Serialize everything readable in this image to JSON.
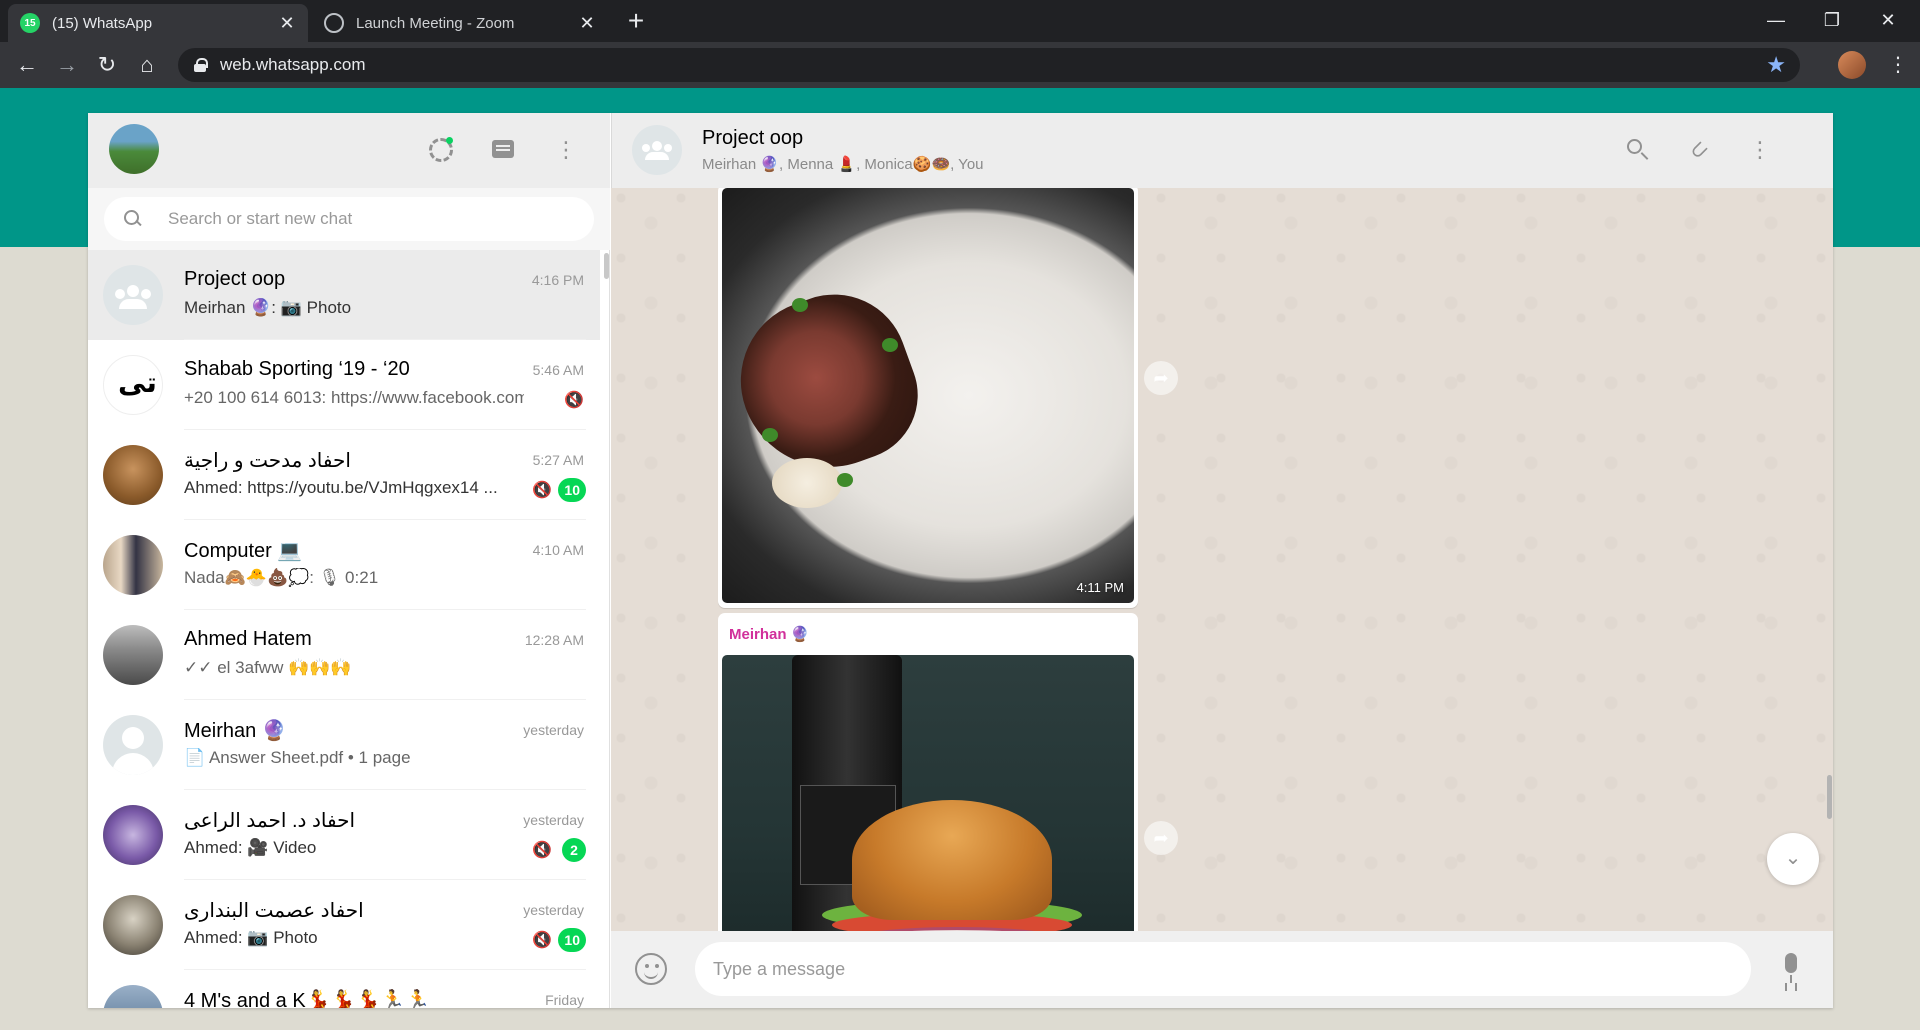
{
  "browser": {
    "tabs": [
      {
        "title": "(15) WhatsApp",
        "favicon_text": "15",
        "active": true
      },
      {
        "title": "Launch Meeting - Zoom",
        "active": false
      }
    ],
    "url": "web.whatsapp.com"
  },
  "sidebar": {
    "search_placeholder": "Search or start new chat",
    "chats": [
      {
        "name": "Project oop",
        "time": "4:16 PM",
        "preview": "Meirhan 🔮: 📷 Photo",
        "selected": true
      },
      {
        "name": "Shabab Sporting ‘19 - ‘20",
        "time": "5:46 AM",
        "preview": "+20 100 614 6013: https://www.facebook.com...",
        "muted": true
      },
      {
        "name": "احفاد مدحت و راجية",
        "time": "5:27 AM",
        "preview": "Ahmed: https://youtu.be/VJmHqgxex14 ...",
        "muted": true,
        "unread": "10"
      },
      {
        "name": "Computer 💻",
        "time": "4:10 AM",
        "preview": "Nada🙈🐣💩💭: 🎙 0:21"
      },
      {
        "name": "Ahmed Hatem",
        "time": "12:28 AM",
        "preview": "✓✓ el 3afww 🙌🙌🙌"
      },
      {
        "name": "Meirhan 🔮",
        "time": "yesterday",
        "preview": "📄 Answer Sheet.pdf • 1 page"
      },
      {
        "name": "احفاد د. احمد الراعى",
        "time": "yesterday",
        "preview": "Ahmed: 🎥 Video",
        "muted": true,
        "unread": "2"
      },
      {
        "name": "احفاد عصمت البندارى",
        "time": "yesterday",
        "preview": "Ahmed: 📷 Photo",
        "muted": true,
        "unread": "10"
      },
      {
        "name": "4 M's and a K💃💃💃🏃🏃",
        "time": "Friday",
        "preview": ""
      }
    ]
  },
  "conversation": {
    "title": "Project oop",
    "members": "Meirhan 🔮, Menna 💄, Monica🍪🍩, You",
    "messages": [
      {
        "type": "photo",
        "time": "4:11 PM"
      },
      {
        "type": "photo",
        "sender": "Meirhan 🔮"
      }
    ],
    "input_placeholder": "Type a message"
  },
  "colors": {
    "teal": "#009688",
    "unread_badge": "#06d755",
    "sender_name": "#d1309b"
  }
}
